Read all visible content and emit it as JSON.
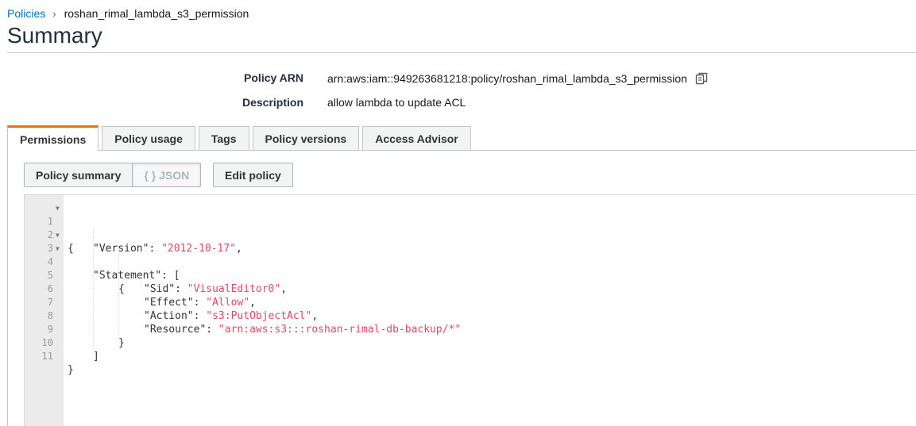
{
  "breadcrumb": {
    "parent": "Policies",
    "separator": "›",
    "current": "roshan_rimal_lambda_s3_permission"
  },
  "page_title": "Summary",
  "details": {
    "arn_label": "Policy ARN",
    "arn_value": "arn:aws:iam::949263681218:policy/roshan_rimal_lambda_s3_permission",
    "description_label": "Description",
    "description_value": "allow lambda to update ACL",
    "copy_icon": "copy-icon"
  },
  "tabs": [
    {
      "label": "Permissions",
      "active": true
    },
    {
      "label": "Policy usage",
      "active": false
    },
    {
      "label": "Tags",
      "active": false
    },
    {
      "label": "Policy versions",
      "active": false
    },
    {
      "label": "Access Advisor",
      "active": false
    }
  ],
  "toolbar": {
    "summary_label": "Policy summary",
    "json_label": "{ } JSON",
    "edit_label": "Edit policy"
  },
  "colors": {
    "accent": "#ec7211",
    "link": "#0073bb",
    "string": "#dd4a68"
  },
  "editor": {
    "lines": [
      {
        "n": "1",
        "fold": true
      },
      {
        "n": "2",
        "fold": false,
        "key": "\"Version\"",
        "value": "\"2012-10-17\""
      },
      {
        "n": "3",
        "fold": true,
        "key": "\"Statement\""
      },
      {
        "n": "4",
        "fold": true
      },
      {
        "n": "5",
        "fold": false,
        "key": "\"Sid\"",
        "value": "\"VisualEditor0\""
      },
      {
        "n": "6",
        "fold": false,
        "key": "\"Effect\"",
        "value": "\"Allow\""
      },
      {
        "n": "7",
        "fold": false,
        "key": "\"Action\"",
        "value": "\"s3:PutObjectAcl\""
      },
      {
        "n": "8",
        "fold": false,
        "key": "\"Resource\"",
        "value": "\"arn:aws:s3:::roshan-rimal-db-backup/*\""
      },
      {
        "n": "9",
        "fold": false
      },
      {
        "n": "10",
        "fold": false
      },
      {
        "n": "11",
        "fold": false
      }
    ],
    "brace_open": "{",
    "brace_close": "}",
    "bracket_open": "[",
    "bracket_close": "]",
    "colon": ": ",
    "comma": ","
  }
}
